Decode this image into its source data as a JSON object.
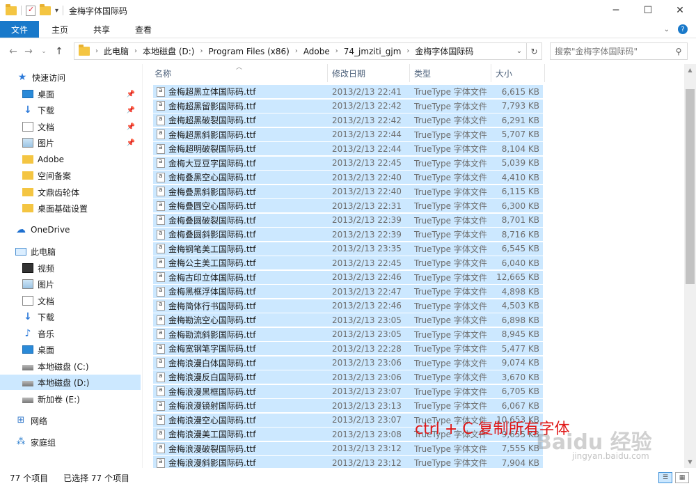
{
  "window": {
    "title": "金梅字体国际码",
    "qa_dropdown": "▾"
  },
  "ribbon": {
    "tabs": [
      "文件",
      "主页",
      "共享",
      "查看"
    ]
  },
  "address": {
    "crumbs": [
      "此电脑",
      "本地磁盘 (D:)",
      "Program Files (x86)",
      "Adobe",
      "74_jmziti_gjm",
      "金梅字体国际码"
    ],
    "search_placeholder": "搜索\"金梅字体国际码\""
  },
  "sidebar": {
    "items": [
      {
        "label": "快速访问",
        "icon": "star-icon",
        "pinned": false
      },
      {
        "label": "桌面",
        "icon": "desktop-icon",
        "pinned": true
      },
      {
        "label": "下载",
        "icon": "download-icon",
        "pinned": true
      },
      {
        "label": "文档",
        "icon": "document-icon",
        "pinned": true
      },
      {
        "label": "图片",
        "icon": "picture-icon",
        "pinned": true
      },
      {
        "label": "Adobe",
        "icon": "folder-icon",
        "pinned": false
      },
      {
        "label": "空间备案",
        "icon": "folder-icon",
        "pinned": false
      },
      {
        "label": "文鼎齿轮体",
        "icon": "folder-icon",
        "pinned": false
      },
      {
        "label": "桌面基础设置",
        "icon": "folder-icon",
        "pinned": false
      },
      {
        "label": "OneDrive",
        "icon": "cloud-icon",
        "pinned": false
      },
      {
        "label": "此电脑",
        "icon": "computer-icon",
        "pinned": false
      },
      {
        "label": "视频",
        "icon": "video-icon",
        "pinned": false
      },
      {
        "label": "图片",
        "icon": "picture-icon",
        "pinned": false
      },
      {
        "label": "文档",
        "icon": "document-icon",
        "pinned": false
      },
      {
        "label": "下载",
        "icon": "download-icon",
        "pinned": false
      },
      {
        "label": "音乐",
        "icon": "music-icon",
        "pinned": false
      },
      {
        "label": "桌面",
        "icon": "desktop-icon",
        "pinned": false
      },
      {
        "label": "本地磁盘 (C:)",
        "icon": "drive-icon",
        "pinned": false
      },
      {
        "label": "本地磁盘 (D:)",
        "icon": "drive-icon",
        "pinned": false,
        "selected": true
      },
      {
        "label": "新加卷 (E:)",
        "icon": "drive-icon",
        "pinned": false
      },
      {
        "label": "网络",
        "icon": "network-icon",
        "pinned": false
      },
      {
        "label": "家庭组",
        "icon": "homegroup-icon",
        "pinned": false
      }
    ]
  },
  "columns": {
    "name": "名称",
    "date": "修改日期",
    "type": "类型",
    "size": "大小"
  },
  "files": [
    {
      "name": "金梅超黑立体国际码.ttf",
      "date": "2013/2/13 22:41",
      "type": "TrueType 字体文件",
      "size": "6,615 KB"
    },
    {
      "name": "金梅超黑留影国际码.ttf",
      "date": "2013/2/13 22:42",
      "type": "TrueType 字体文件",
      "size": "7,793 KB"
    },
    {
      "name": "金梅超黑破裂国际码.ttf",
      "date": "2013/2/13 22:42",
      "type": "TrueType 字体文件",
      "size": "6,291 KB"
    },
    {
      "name": "金梅超黑斜影国际码.ttf",
      "date": "2013/2/13 22:44",
      "type": "TrueType 字体文件",
      "size": "5,707 KB"
    },
    {
      "name": "金梅超明破裂国际码.ttf",
      "date": "2013/2/13 22:44",
      "type": "TrueType 字体文件",
      "size": "8,104 KB"
    },
    {
      "name": "金梅大豆豆字国际码.ttf",
      "date": "2013/2/13 22:45",
      "type": "TrueType 字体文件",
      "size": "5,039 KB"
    },
    {
      "name": "金梅叠黑空心国际码.ttf",
      "date": "2013/2/13 22:40",
      "type": "TrueType 字体文件",
      "size": "4,410 KB"
    },
    {
      "name": "金梅叠黑斜影国际码.ttf",
      "date": "2013/2/13 22:40",
      "type": "TrueType 字体文件",
      "size": "6,115 KB"
    },
    {
      "name": "金梅叠圆空心国际码.ttf",
      "date": "2013/2/13 22:31",
      "type": "TrueType 字体文件",
      "size": "6,300 KB"
    },
    {
      "name": "金梅叠圆破裂国际码.ttf",
      "date": "2013/2/13 22:39",
      "type": "TrueType 字体文件",
      "size": "8,701 KB"
    },
    {
      "name": "金梅叠圆斜影国际码.ttf",
      "date": "2013/2/13 22:39",
      "type": "TrueType 字体文件",
      "size": "8,716 KB"
    },
    {
      "name": "金梅钢笔美工国际码.ttf",
      "date": "2013/2/13 23:35",
      "type": "TrueType 字体文件",
      "size": "6,545 KB"
    },
    {
      "name": "金梅公主美工国际码.ttf",
      "date": "2013/2/13 22:45",
      "type": "TrueType 字体文件",
      "size": "6,040 KB"
    },
    {
      "name": "金梅古印立体国际码.ttf",
      "date": "2013/2/13 22:46",
      "type": "TrueType 字体文件",
      "size": "12,665 KB"
    },
    {
      "name": "金梅黑框浮体国际码.ttf",
      "date": "2013/2/13 22:47",
      "type": "TrueType 字体文件",
      "size": "4,898 KB"
    },
    {
      "name": "金梅简体行书国际码.ttf",
      "date": "2013/2/13 22:46",
      "type": "TrueType 字体文件",
      "size": "4,503 KB"
    },
    {
      "name": "金梅勘流空心国际码.ttf",
      "date": "2013/2/13 23:05",
      "type": "TrueType 字体文件",
      "size": "6,898 KB"
    },
    {
      "name": "金梅勘流斜影国际码.ttf",
      "date": "2013/2/13 23:05",
      "type": "TrueType 字体文件",
      "size": "8,945 KB"
    },
    {
      "name": "金梅宽钢笔字国际码.ttf",
      "date": "2013/2/13 22:28",
      "type": "TrueType 字体文件",
      "size": "5,477 KB"
    },
    {
      "name": "金梅浪漫白体国际码.ttf",
      "date": "2013/2/13 23:06",
      "type": "TrueType 字体文件",
      "size": "9,074 KB"
    },
    {
      "name": "金梅浪漫反白国际码.ttf",
      "date": "2013/2/13 23:06",
      "type": "TrueType 字体文件",
      "size": "3,670 KB"
    },
    {
      "name": "金梅浪漫黑框国际码.ttf",
      "date": "2013/2/13 23:07",
      "type": "TrueType 字体文件",
      "size": "6,705 KB"
    },
    {
      "name": "金梅浪漫镜射国际码.ttf",
      "date": "2013/2/13 23:13",
      "type": "TrueType 字体文件",
      "size": "6,067 KB"
    },
    {
      "name": "金梅浪漫空心国际码.ttf",
      "date": "2013/2/13 23:07",
      "type": "TrueType 字体文件",
      "size": "10,653 KB"
    },
    {
      "name": "金梅浪漫美工国际码.ttf",
      "date": "2013/2/13 23:08",
      "type": "TrueType 字体文件",
      "size": "9,655 KB"
    },
    {
      "name": "金梅浪漫破裂国际码.ttf",
      "date": "2013/2/13 23:12",
      "type": "TrueType 字体文件",
      "size": "7,555 KB"
    },
    {
      "name": "金梅浪漫斜影国际码.ttf",
      "date": "2013/2/13 23:12",
      "type": "TrueType 字体文件",
      "size": "7,904 KB"
    }
  ],
  "status": {
    "count": "77 个项目",
    "selected": "已选择 77 个项目"
  },
  "annotation": "ctrl + C  复制所有字体",
  "watermark": {
    "text": "Baidu 经验",
    "url": "jingyan.baidu.com"
  },
  "colors": {
    "accent": "#1979ca",
    "selection": "#cce8ff",
    "annotation": "#e01818"
  }
}
